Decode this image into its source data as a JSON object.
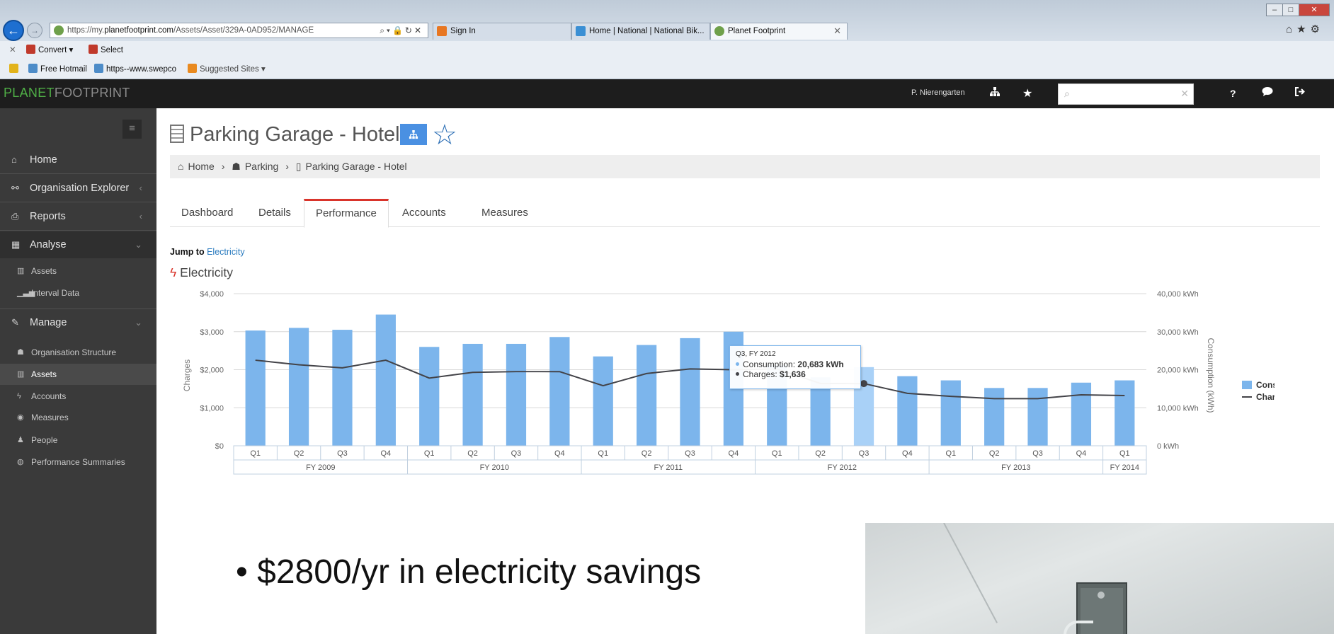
{
  "browser": {
    "address": {
      "prefix": "https://my.",
      "domain": "planetfootprint.com",
      "path": "/Assets/Asset/329A-0AD952/MANAGE"
    },
    "tabs": [
      {
        "label": "Sign In",
        "icon": "pe-icon",
        "color": "#e87722"
      },
      {
        "label": "Home | National | National Bik...",
        "icon": "map-icon",
        "color": "#3a8fd4"
      },
      {
        "label": "Planet Footprint",
        "icon": "planet-icon",
        "color": "#6fa04a"
      }
    ],
    "command_bar": {
      "convert": "Convert",
      "select": "Select"
    },
    "favorites": {
      "hotmail": "Free Hotmail",
      "swepco": "https--www.swepco",
      "suggested": "Suggested Sites"
    }
  },
  "app": {
    "logo_part1": "PLANET",
    "logo_part2": "FOOTPRINT",
    "user": "P. Nierengarten"
  },
  "sidebar": {
    "items": [
      {
        "label": "Home"
      },
      {
        "label": "Organisation Explorer"
      },
      {
        "label": "Reports"
      },
      {
        "label": "Analyse"
      }
    ],
    "analyse_sub": [
      {
        "label": "Assets"
      },
      {
        "label": "Interval Data"
      }
    ],
    "manage": {
      "label": "Manage"
    },
    "manage_sub": [
      {
        "label": "Organisation Structure"
      },
      {
        "label": "Assets"
      },
      {
        "label": "Accounts"
      },
      {
        "label": "Measures"
      },
      {
        "label": "People"
      },
      {
        "label": "Performance Summaries"
      }
    ]
  },
  "page": {
    "title": "Parking Garage - Hotel",
    "breadcrumb": [
      "Home",
      "Parking",
      "Parking Garage - Hotel"
    ],
    "tabs": [
      "Dashboard",
      "Details",
      "Performance",
      "Accounts",
      "Measures"
    ],
    "jump_to_label": "Jump to",
    "jump_to_link": "Electricity",
    "section_title": "Electricity"
  },
  "chart_data": {
    "type": "bar",
    "categories": [
      "Q1",
      "Q2",
      "Q3",
      "Q4",
      "Q1",
      "Q2",
      "Q3",
      "Q4",
      "Q1",
      "Q2",
      "Q3",
      "Q4",
      "Q1",
      "Q2",
      "Q3",
      "Q4",
      "Q1",
      "Q2",
      "Q3",
      "Q4",
      "Q1"
    ],
    "fiscal_years": [
      {
        "label": "FY 2009",
        "quarters": 4
      },
      {
        "label": "FY 2010",
        "quarters": 4
      },
      {
        "label": "FY 2011",
        "quarters": 4
      },
      {
        "label": "FY 2012",
        "quarters": 4
      },
      {
        "label": "FY 2013",
        "quarters": 4
      },
      {
        "label": "FY 2014",
        "quarters": 1
      }
    ],
    "series": [
      {
        "name": "Consumption",
        "axis": "right",
        "color": "#7cb5ec",
        "highlight_color": "#a9d1f7",
        "values": [
          30300,
          31000,
          30500,
          34500,
          26000,
          26800,
          26800,
          28600,
          23500,
          26500,
          28300,
          30000,
          21200,
          18000,
          20683,
          18300,
          17200,
          15200,
          15200,
          16600,
          17200
        ]
      },
      {
        "name": "Charges",
        "axis": "left",
        "color": "#434348",
        "values": [
          2250,
          2130,
          2050,
          2250,
          1780,
          1930,
          1950,
          1950,
          1580,
          1900,
          2020,
          2000,
          2020,
          1640,
          1636,
          1380,
          1300,
          1240,
          1240,
          1340,
          1320
        ]
      }
    ],
    "left_axis": {
      "label": "Charges",
      "ticks": [
        "$0",
        "$1,000",
        "$2,000",
        "$3,000",
        "$4,000"
      ],
      "range": [
        0,
        4000
      ]
    },
    "right_axis": {
      "label": "Consumption (kWh)",
      "ticks": [
        "0 kWh",
        "10,000 kWh",
        "20,000 kWh",
        "30,000 kWh",
        "40,000 kWh"
      ],
      "range": [
        0,
        40000
      ]
    },
    "legend": [
      "Consumption",
      "Charges"
    ],
    "legend_position": "right",
    "highlight_index": 14,
    "tooltip": {
      "title": "Q3, FY 2012",
      "consumption_label": "Consumption:",
      "consumption_value": "20,683 kWh",
      "charges_label": "Charges:",
      "charges_value": "$1,636"
    }
  },
  "slide": {
    "bullet": "• $2800/yr in electricity savings"
  }
}
